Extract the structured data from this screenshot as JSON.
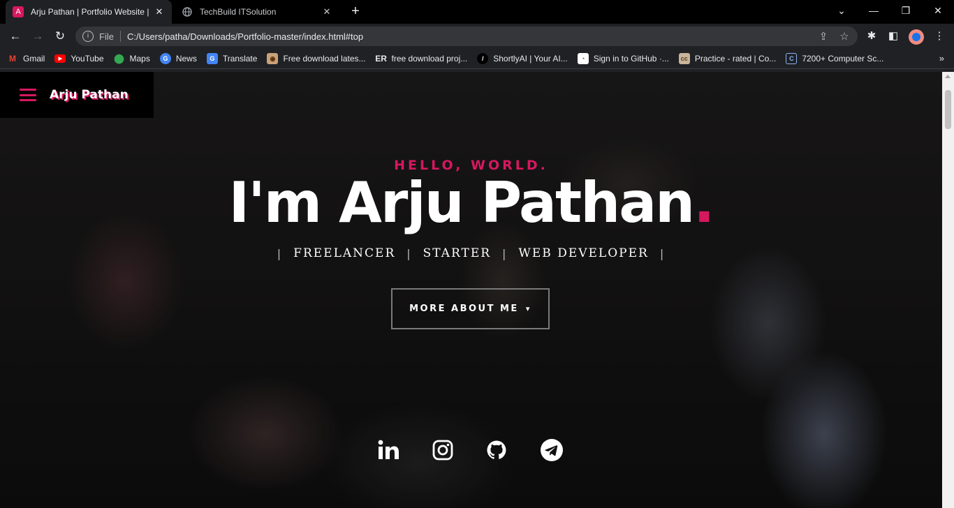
{
  "browser": {
    "tabs": [
      {
        "title": "Arju Pathan | Portfolio Website | I",
        "favicon": "A",
        "favicon_color": "#d6185f"
      },
      {
        "title": "TechBuild ITSolution",
        "favicon": "globe-icon"
      }
    ],
    "omnibox": {
      "scheme": "File",
      "url": "C:/Users/patha/Downloads/Portfolio-master/index.html#top"
    },
    "bookmarks": [
      {
        "label": "Gmail",
        "icon": "gmail-icon"
      },
      {
        "label": "YouTube",
        "icon": "youtube-icon"
      },
      {
        "label": "Maps",
        "icon": "maps-icon"
      },
      {
        "label": "News",
        "icon": "news-icon"
      },
      {
        "label": "Translate",
        "icon": "translate-icon"
      },
      {
        "label": "Free download lates...",
        "icon": "download-site-icon"
      },
      {
        "label": "free download proj...",
        "icon": "er-icon"
      },
      {
        "label": "ShortlyAI | Your AI...",
        "icon": "shortlyai-icon"
      },
      {
        "label": "Sign in to GitHub ·...",
        "icon": "github-icon"
      },
      {
        "label": "Practice - rated | Co...",
        "icon": "codechef-icon"
      },
      {
        "label": "7200+ Computer Sc...",
        "icon": "computer-science-icon"
      }
    ]
  },
  "site": {
    "logo": "Arju Pathan",
    "greeting": "HELLO, WORLD.",
    "headline": "I'm Arju Pathan",
    "headline_dot": ".",
    "roles": [
      "FREELANCER",
      "STARTER",
      "WEB DEVELOPER"
    ],
    "role_separator": "|",
    "cta_label": "MORE ABOUT ME",
    "socials": [
      "linkedin-icon",
      "instagram-icon",
      "github-icon",
      "telegram-icon"
    ],
    "accent": "#d6185f"
  }
}
